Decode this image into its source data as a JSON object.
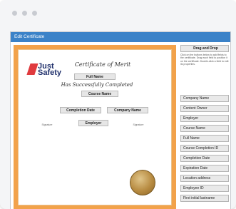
{
  "window": {
    "traffic_lights": [
      "",
      "",
      ""
    ]
  },
  "panel": {
    "title": "Edit Certificate"
  },
  "certificate": {
    "logo_line1": "Just",
    "logo_line2": "Safety",
    "heading_script": "Certificate of Merit",
    "full_name_label": "Full Name",
    "completed_script": "Has Successfully Completed",
    "course_name_label": "Course Name",
    "completion_date_label": "Completion Date",
    "company_name_label": "Company Name",
    "employer_label": "Employer",
    "sig1": "Signature",
    "sig2": "Signature"
  },
  "sidebar": {
    "top_button": "Drag and Drop",
    "help_text": "Click on the buttons below to add fields to the certificate. Drag each field to position it on the certificate. Double-click a field to edit its properties.",
    "items": [
      "Company Name",
      "Content Owner",
      "Employer",
      "Course Name",
      "Full Name",
      "Course Completion ID",
      "Completion Date",
      "Expiration Date",
      "Location address",
      "Employee ID",
      "First initial lastname"
    ]
  }
}
